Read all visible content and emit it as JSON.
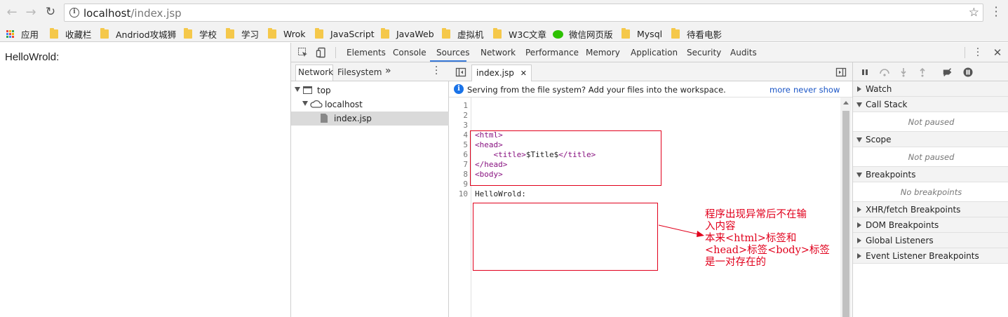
{
  "browser": {
    "url_host": "localhost",
    "url_path": "/index.jsp"
  },
  "bookmarks": [
    {
      "label": "应用",
      "icon": "apps-grid-icon"
    },
    {
      "label": "收藏栏",
      "icon": "folder-icon"
    },
    {
      "label": "Andriod攻城狮",
      "icon": "folder-icon"
    },
    {
      "label": "学校",
      "icon": "folder-icon"
    },
    {
      "label": "学习",
      "icon": "folder-icon"
    },
    {
      "label": "Wrok",
      "icon": "folder-icon"
    },
    {
      "label": "JavaScript",
      "icon": "folder-icon"
    },
    {
      "label": "JavaWeb",
      "icon": "folder-icon"
    },
    {
      "label": "虚拟机",
      "icon": "folder-icon"
    },
    {
      "label": "W3C文章",
      "icon": "folder-icon"
    },
    {
      "label": "微信网页版",
      "icon": "wechat-icon"
    },
    {
      "label": "Mysql",
      "icon": "folder-icon"
    },
    {
      "label": "待看电影",
      "icon": "folder-icon"
    }
  ],
  "page": {
    "text": "HelloWrold:"
  },
  "devtools": {
    "tabs": [
      "Elements",
      "Console",
      "Sources",
      "Network",
      "Performance",
      "Memory",
      "Application",
      "Security",
      "Audits"
    ],
    "active_tab": "Sources",
    "navigator": {
      "tabs": [
        "Network",
        "Filesystem"
      ],
      "more": "»",
      "tree": {
        "top": "top",
        "host": "localhost",
        "file": "index.jsp"
      }
    },
    "editor": {
      "open_file": "index.jsp",
      "infobar": {
        "message": "Serving from the file system? Add your files into the workspace.",
        "more": "more",
        "never_show": "never show"
      },
      "line_numbers": [
        "1",
        "2",
        "3",
        "4",
        "5",
        "6",
        "7",
        "8",
        "9",
        "10"
      ],
      "lines": [
        "",
        "",
        "",
        "<html>",
        "<head>",
        "    <title>$Title$</title>",
        "</head>",
        "<body>",
        "",
        "HelloWrold:"
      ]
    },
    "debugger": {
      "sections": [
        {
          "label": "Watch",
          "expanded": false
        },
        {
          "label": "Call Stack",
          "expanded": true,
          "empty": "Not paused"
        },
        {
          "label": "Scope",
          "expanded": true,
          "empty": "Not paused"
        },
        {
          "label": "Breakpoints",
          "expanded": true,
          "empty": "No breakpoints"
        },
        {
          "label": "XHR/fetch Breakpoints",
          "expanded": false
        },
        {
          "label": "DOM Breakpoints",
          "expanded": false
        },
        {
          "label": "Global Listeners",
          "expanded": false
        },
        {
          "label": "Event Listener Breakpoints",
          "expanded": false
        }
      ]
    }
  },
  "annotation": {
    "lines": [
      "程序出现异常后不在输",
      "入内容",
      "本来<html>标签和",
      "<head>标签<body>标签",
      "是一对存在的"
    ],
    "color": "#e1001c"
  },
  "colors": {
    "accent": "#3879d9",
    "link": "#1a55c6",
    "tag": "#881280",
    "annotation_red": "#e1001c",
    "folder": "#f5c84a",
    "wechat": "#2dc100"
  }
}
